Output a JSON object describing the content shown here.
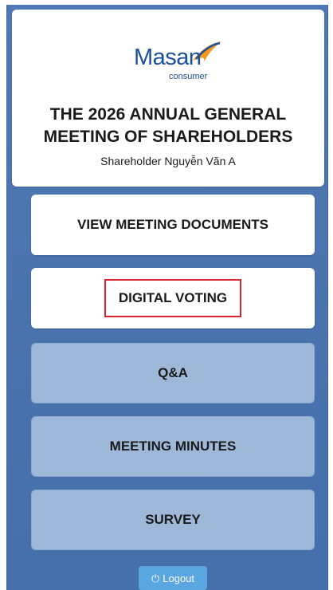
{
  "header": {
    "logo_brand": "Masan",
    "logo_sub": "consumer",
    "title_line1": "THE 2026 ANNUAL GENERAL",
    "title_line2": "MEETING OF SHAREHOLDERS",
    "shareholder": "Shareholder Nguyễn Văn A"
  },
  "menu": {
    "view_documents": "VIEW MEETING DOCUMENTS",
    "digital_voting": "DIGITAL VOTING",
    "qa": "Q&A",
    "meeting_minutes": "MEETING MINUTES",
    "survey": "SURVEY"
  },
  "footer": {
    "logout_label": "Logout",
    "logout_icon": "power-icon"
  },
  "colors": {
    "background": "#4a73ae",
    "muted_button": "#9db8d8",
    "highlight": "#d9232e",
    "logout": "#5aa6e0",
    "brand": "#1b4f9c",
    "swoosh": "#f39a1f"
  }
}
